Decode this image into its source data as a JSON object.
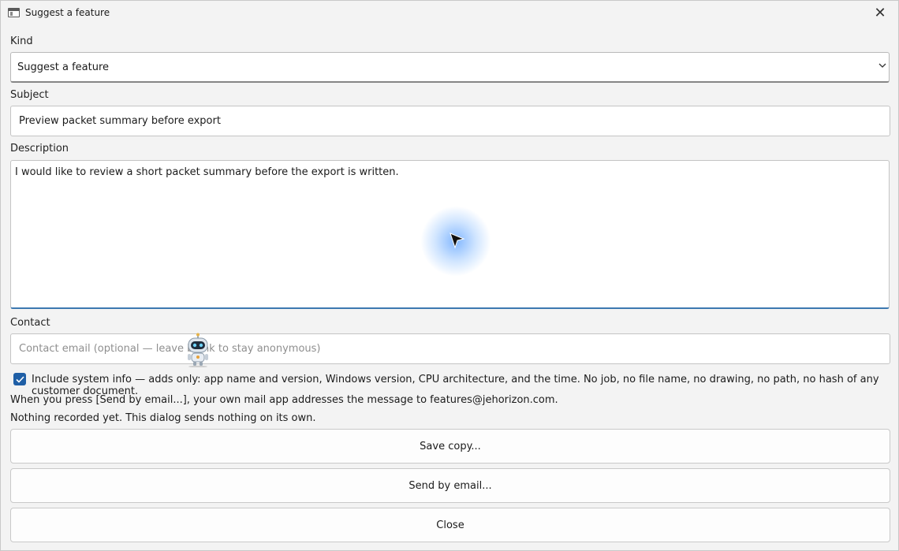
{
  "window": {
    "title": "Suggest a feature",
    "close_glyph": "✕",
    "title_icon": "window-icon"
  },
  "kind": {
    "label": "Kind",
    "selected": "Suggest a feature",
    "chevron_icon": "chevron-down-icon"
  },
  "subject": {
    "label": "Subject",
    "value": "Preview packet summary before export"
  },
  "description": {
    "label": "Description",
    "value": "I would like to review a short packet summary before the export is written."
  },
  "contact": {
    "label": "Contact",
    "placeholder": "Contact email (optional — leave blank to stay anonymous)",
    "value": ""
  },
  "system_info": {
    "checked": true,
    "label": "Include system info — adds only: app name and version, Windows version, CPU architecture, and the time. No job, no file name, no drawing, no path, no hash of any customer document."
  },
  "notes": {
    "mail_note": "When you press [Send by email...], your own mail app addresses the message to features@jehorizon.com.",
    "status": "Nothing recorded yet. This dialog sends nothing on its own."
  },
  "buttons": {
    "save": "Save copy...",
    "send": "Send by email...",
    "close": "Close"
  },
  "colors": {
    "accent": "#1f5fa6",
    "focus_underline": "#3d78b0"
  }
}
